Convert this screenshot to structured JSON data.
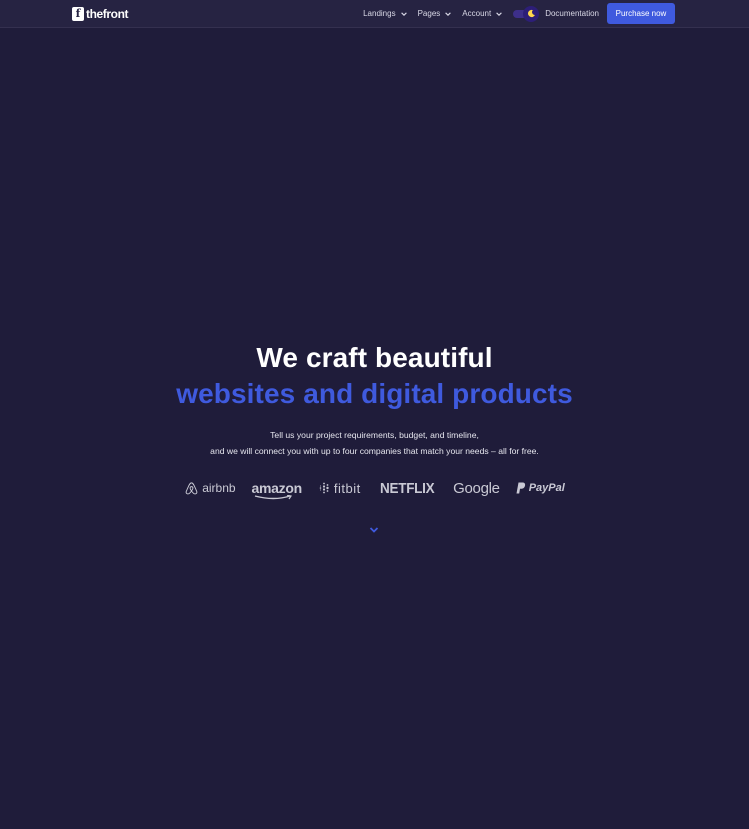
{
  "header": {
    "logo": {
      "mark": "f",
      "text": "thefront"
    },
    "nav": [
      {
        "label": "Landings"
      },
      {
        "label": "Pages"
      },
      {
        "label": "Account"
      }
    ],
    "documentation_label": "Documentation",
    "purchase_label": "Purchase now"
  },
  "hero": {
    "title_line1": "We craft beautiful",
    "title_line2": "websites and digital products",
    "subtitle_line1": "Tell us your project requirements, budget, and timeline,",
    "subtitle_line2": "and we will connect you with up to four companies that match your needs – all for free."
  },
  "brands": {
    "airbnb": "airbnb",
    "amazon": "amazon",
    "fitbit": "fitbit",
    "netflix": "NETFLIX",
    "google": "Google",
    "paypal": "PayPal"
  },
  "icons": {
    "dropdown": "chevron-down-icon",
    "theme_toggle": "moon-icon",
    "scroll": "chevron-down-icon"
  },
  "colors": {
    "background": "#1f1c3a",
    "navbar": "#262342",
    "accent": "#3f5ade",
    "text": "#ffffff"
  }
}
